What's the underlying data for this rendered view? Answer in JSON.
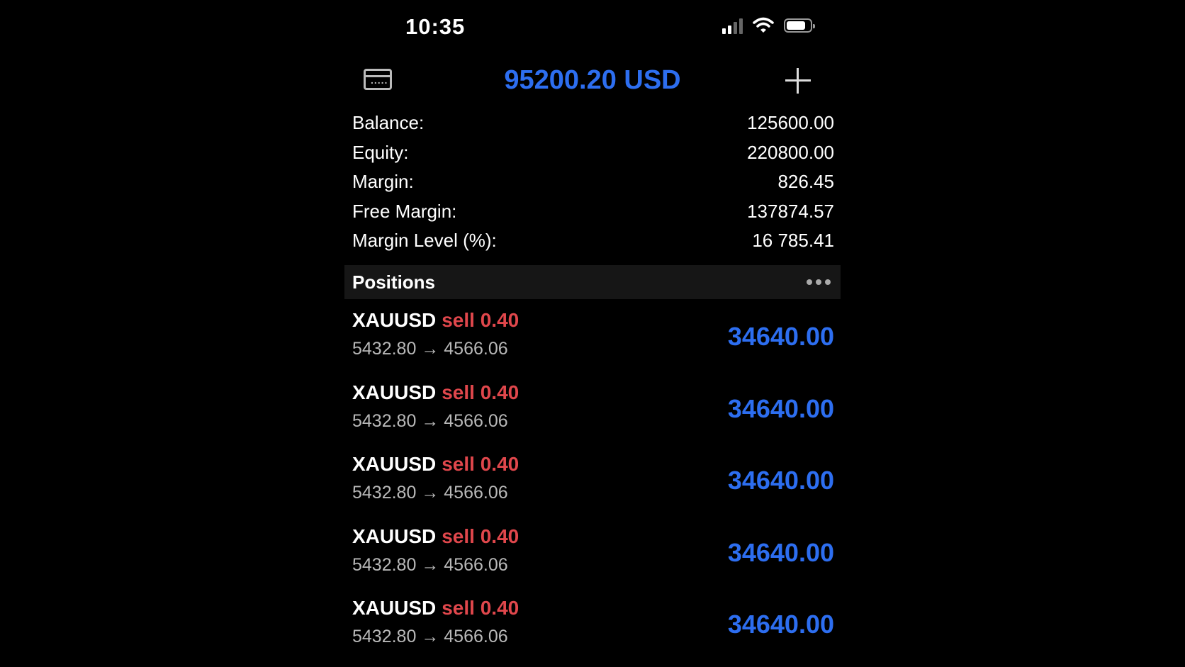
{
  "status_bar": {
    "time": "10:35"
  },
  "header": {
    "title": "95200.20 USD"
  },
  "account": [
    {
      "label": "Balance:",
      "value": "125600.00"
    },
    {
      "label": "Equity:",
      "value": "220800.00"
    },
    {
      "label": "Margin:",
      "value": "826.45"
    },
    {
      "label": "Free Margin:",
      "value": "137874.57"
    },
    {
      "label": "Margin Level (%):",
      "value": "16 785.41"
    }
  ],
  "positions": {
    "title": "Positions",
    "items": [
      {
        "symbol": "XAUUSD",
        "side": "sell 0.40",
        "prices": "5432.80 → 4566.06",
        "profit": "34640.00"
      },
      {
        "symbol": "XAUUSD",
        "side": "sell 0.40",
        "prices": "5432.80 → 4566.06",
        "profit": "34640.00"
      },
      {
        "symbol": "XAUUSD",
        "side": "sell 0.40",
        "prices": "5432.80 → 4566.06",
        "profit": "34640.00"
      },
      {
        "symbol": "XAUUSD",
        "side": "sell 0.40",
        "prices": "5432.80 → 4566.06",
        "profit": "34640.00"
      },
      {
        "symbol": "XAUUSD",
        "side": "sell 0.40",
        "prices": "5432.80 → 4566.06",
        "profit": "34640.00"
      }
    ]
  },
  "colors": {
    "accent": "#2d6ef0",
    "sell": "#e0474c",
    "background": "#000000"
  },
  "icons": [
    "signal-icon",
    "wifi-icon",
    "battery-icon",
    "card-icon",
    "plus-icon",
    "more-icon"
  ]
}
